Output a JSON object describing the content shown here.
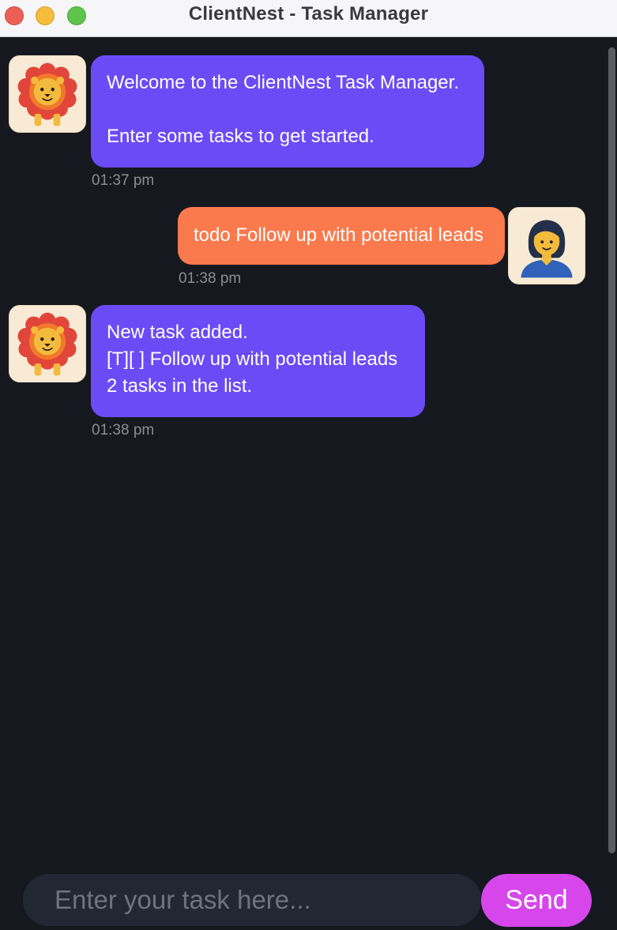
{
  "window": {
    "title": "ClientNest - Task Manager"
  },
  "messages": [
    {
      "sender": "bot",
      "avatar_icon": "lion-icon",
      "text": "Welcome to the ClientNest Task Manager.\n\nEnter some tasks to get started.",
      "time": "01:37 pm"
    },
    {
      "sender": "user",
      "avatar_icon": "user-avatar-icon",
      "text": "todo Follow up with potential leads",
      "time": "01:38 pm"
    },
    {
      "sender": "bot",
      "avatar_icon": "lion-icon",
      "text": "New task added.\n [T][ ] Follow up with potential leads\n2 tasks in the list.",
      "time": "01:38 pm"
    }
  ],
  "input": {
    "placeholder": "Enter your task here...",
    "value": ""
  },
  "send_button": {
    "label": "Send"
  },
  "colors": {
    "background": "#15181f",
    "bot_bubble": "#6b4bf5",
    "user_bubble": "#fa7a4d",
    "send_button": "#d646ea",
    "input_background": "#222733",
    "timestamp": "#8a8d93"
  }
}
